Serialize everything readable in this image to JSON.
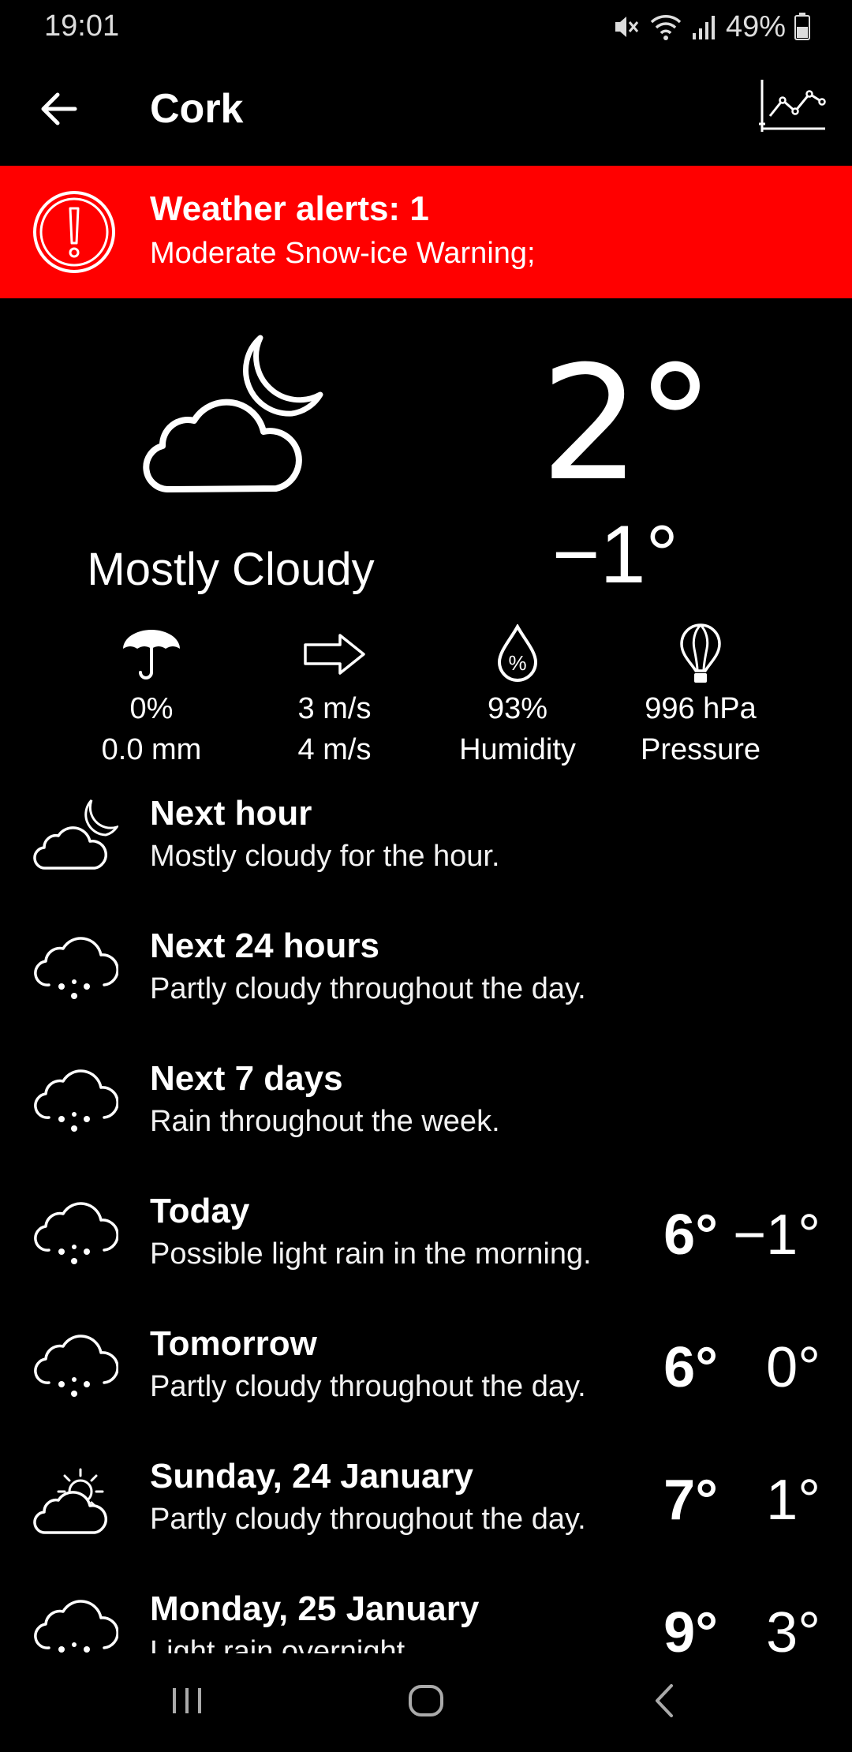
{
  "status_bar": {
    "time": "19:01",
    "battery": "49%",
    "icons": [
      "mute-icon",
      "wifi-icon",
      "signal-icon",
      "battery-icon"
    ]
  },
  "app_bar": {
    "title": "Cork",
    "back_icon": "arrow-left-icon",
    "chart_icon": "line-chart-icon"
  },
  "alert": {
    "title": "Weather alerts: 1",
    "text": "Moderate Snow-ice Warning;",
    "color": "#ff0000",
    "icon": "exclamation-circle-icon"
  },
  "current": {
    "icon": "cloud-moon-icon",
    "condition": "Mostly Cloudy",
    "temperature": "2°",
    "feels_like": "−1°"
  },
  "stats": [
    {
      "icon": "umbrella-icon",
      "line1": "0%",
      "line2": "0.0 mm"
    },
    {
      "icon": "wind-arrow-icon",
      "line1": "3 m/s",
      "line2": "4 m/s"
    },
    {
      "icon": "humidity-drop-icon",
      "line1": "93%",
      "line2": "Humidity"
    },
    {
      "icon": "balloon-pressure-icon",
      "line1": "996 hPa",
      "line2": "Pressure"
    }
  ],
  "forecast": [
    {
      "icon": "cloud-moon-icon",
      "title": "Next hour",
      "subtitle": "Mostly cloudy for the hour.",
      "high": "",
      "low": ""
    },
    {
      "icon": "cloud-rain-icon",
      "title": "Next 24 hours",
      "subtitle": "Partly cloudy throughout the day.",
      "high": "",
      "low": ""
    },
    {
      "icon": "cloud-rain-icon",
      "title": "Next 7 days",
      "subtitle": "Rain throughout the week.",
      "high": "",
      "low": ""
    },
    {
      "icon": "cloud-rain-icon",
      "title": "Today",
      "subtitle": "Possible light rain in the morning.",
      "high": "6°",
      "low": "−1°"
    },
    {
      "icon": "cloud-rain-icon",
      "title": "Tomorrow",
      "subtitle": "Partly cloudy throughout the day.",
      "high": "6°",
      "low": "0°"
    },
    {
      "icon": "cloud-sun-icon",
      "title": "Sunday, 24 January",
      "subtitle": "Partly cloudy throughout the day.",
      "high": "7°",
      "low": "1°"
    },
    {
      "icon": "cloud-rain-icon",
      "title": "Monday, 25 January",
      "subtitle": "Light rain overnight.",
      "high": "9°",
      "low": "3°"
    }
  ],
  "nav": {
    "recents_icon": "recents-icon",
    "home_icon": "home-icon",
    "back_icon": "nav-back-icon"
  }
}
